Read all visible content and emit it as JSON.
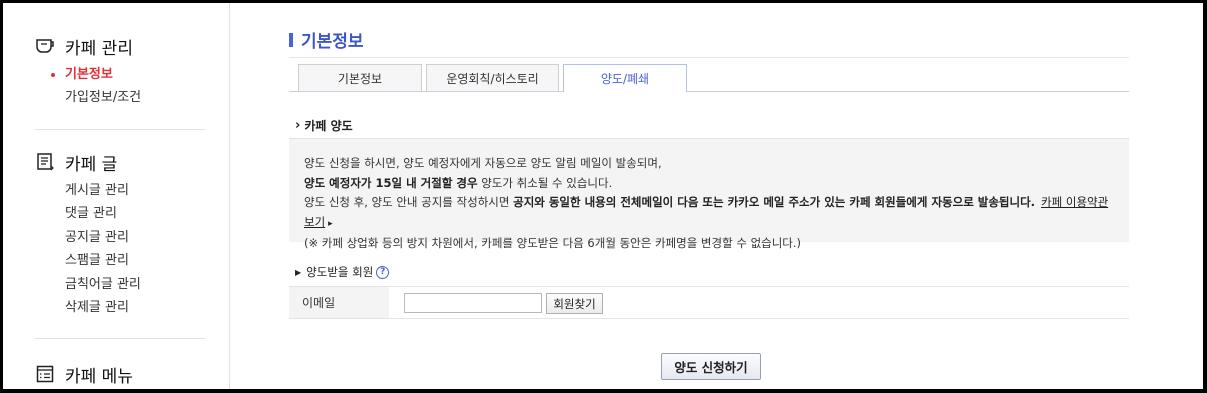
{
  "sidebar": {
    "sections": [
      {
        "title": "카페 관리",
        "icon": "cup-icon",
        "items": [
          "기본정보",
          "가입정보/조건"
        ],
        "active_index": 0
      },
      {
        "title": "카페 글",
        "icon": "document-icon",
        "items": [
          "게시글 관리",
          "댓글 관리",
          "공지글 관리",
          "스팸글 관리",
          "금칙어글 관리",
          "삭제글 관리"
        ]
      },
      {
        "title": "카페 메뉴",
        "icon": "menu-list-icon",
        "items": []
      }
    ]
  },
  "main": {
    "page_title": "기본정보",
    "tabs": [
      {
        "label": "기본정보"
      },
      {
        "label": "운영회칙/히스토리"
      },
      {
        "label": "양도/폐쇄",
        "active": true
      }
    ],
    "transfer_heading": "카페 양도",
    "notice": {
      "line1": "양도 신청을 하시면, 양도 예정자에게 자동으로 양도 알림 메일이 발송되며,",
      "line2_bold": "양도 예정자가 15일 내 거절할 경우",
      "line2_rest": " 양도가 취소될 수 있습니다.",
      "line3_plain": "양도 신청 후, 양도 안내 공지를 작성하시면 ",
      "line3_bold": "공지와 동일한 내용의 전체메일이 다음 또는 카카오 메일 주소가 있는 카페 회원들에게 자동으로 발송됩니다.",
      "terms_link": "카페 이용약관 보기",
      "line4": "(※ 카페 상업화 등의 방지 차원에서, 카페를 양도받은 다음 6개월 동안은 카페명을 변경할 수 없습니다.)"
    },
    "recipient_heading": "양도받을 회원",
    "help_symbol": "?",
    "form": {
      "email_label": "이메일",
      "email_value": "",
      "find_button": "회원찾기"
    },
    "submit_button": "양도 신청하기"
  }
}
